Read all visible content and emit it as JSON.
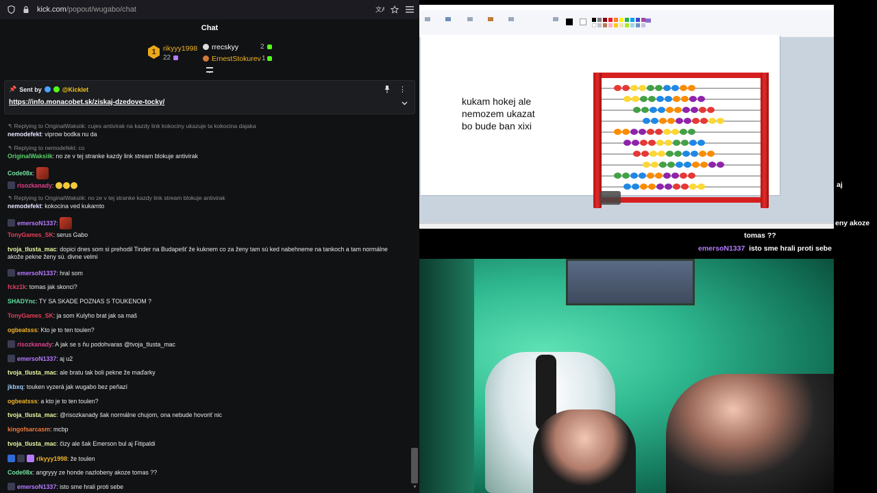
{
  "browser": {
    "url_host": "kick.com",
    "url_path": "/popout/wugabo/chat"
  },
  "chat": {
    "title": "Chat",
    "leaderboard": {
      "first": {
        "rank": "1",
        "name": "rikyyy1998",
        "count": "22"
      },
      "second": {
        "name": "rrecskyy",
        "count": "2"
      },
      "third": {
        "name": "ErnestStokurev",
        "count": "1"
      }
    },
    "pinned": {
      "sent_by_label": "Sent by",
      "author": "@Kicklet",
      "link": "https://info.monacobet.sk/ziskaj-dzedove-tocky/"
    },
    "messages": [
      {
        "type": "reply",
        "text": "Replying to OriginalWaksiik: cujes antivirak na kazdy link kokociny ukazuje ta kokocina dajaka"
      },
      {
        "user": "nemodefekt",
        "color": "#e6e6ff",
        "text": ": viprow bodka nu da"
      },
      {
        "type": "reply",
        "text": "Replying to nemodefekt: co"
      },
      {
        "user": "OriginalWaksiik",
        "color": "#59d36b",
        "text": ": no ze v tej stranke kazdy link stream blokuje antivirak"
      },
      {
        "user": "Code08x",
        "color": "#74e3a2",
        "text": ":"
      },
      {
        "user": "risozkanady",
        "color": "#e0408a",
        "text": ":"
      },
      {
        "type": "reply",
        "text": "Replying to OriginalWaksiik: no ze v tej stranke kazdy link stream blokuje antivirak"
      },
      {
        "user": "nemodefekt",
        "color": "#e6e6ff",
        "text": ": kokocina ved kukamto"
      },
      {
        "user": "emersoN1337",
        "color": "#b57bff",
        "text": ":"
      },
      {
        "user": "TonyGames_SK",
        "color": "#e0405a",
        "text": ": serus Gabo"
      },
      {
        "user": "tvoja_tlusta_mac",
        "color": "#e8f5a0",
        "text": ": dopici dnes som si prehodil Tinder na Budapešť že kuknem co za ženy tam sú ked nabehneme na tankoch a tam normálne akože pekne ženy sú. divne velmi"
      },
      {
        "user": "emersoN1337",
        "color": "#b57bff",
        "text": ": hral som"
      },
      {
        "user": "fckz1k",
        "color": "#e04060",
        "text": ": tomas jak skonci?"
      },
      {
        "user": "SHADYnc",
        "color": "#5fe0a0",
        "text": ": TY SA SKADE POZNAS S TOUKENOM ?"
      },
      {
        "user": "TonyGames_SK",
        "color": "#e0405a",
        "text": ": ja som Kulyho brat jak sa maš"
      },
      {
        "user": "ogbeatsss",
        "color": "#f0b429",
        "text": ": Kto je to ten toulen?"
      },
      {
        "user": "risozkanady",
        "color": "#e0408a",
        "text": ": A jak se s ňu podohvaras @tvoja_tlusta_mac"
      },
      {
        "user": "emersoN1337",
        "color": "#b57bff",
        "text": ": aj u2"
      },
      {
        "user": "tvoja_tlusta_mac",
        "color": "#e8f5a0",
        "text": ": ale bratu tak boli pekne že maďarky"
      },
      {
        "user": "jkbxq",
        "color": "#9fd0ff",
        "text": ": touken vyzerá jak wugabo bez peňazí"
      },
      {
        "user": "ogbeatsss",
        "color": "#f0b429",
        "text": ": a kto je to ten toulen?"
      },
      {
        "user": "tvoja_tlusta_mac",
        "color": "#e8f5a0",
        "text": ": @risozkanady šak normálne chujom, ona nebude hovoriť nic"
      },
      {
        "user": "kingofsarcasm",
        "color": "#f07a3a",
        "text": ": mcbp"
      },
      {
        "user": "tvoja_tlusta_mac",
        "color": "#e8f5a0",
        "text": ": čizy ale šak Emerson bul aj Fitipaldi"
      },
      {
        "user": "rikyyy1998",
        "color": "#f0b429",
        "text": ": že toulen"
      },
      {
        "user": "Code08x",
        "color": "#74e3a2",
        "text": ": angryyy ze honde nazlobeny akoze tomas ??"
      },
      {
        "user": "emersoN1337",
        "color": "#b57bff",
        "text": ": isto sme hrali proti sebe"
      }
    ]
  },
  "paint": {
    "canvas_text": "kukam hokej ale\nnemozem ukazat\nbo bude ban xixi"
  },
  "overlay": {
    "line1": "aj",
    "line2": "eny akoze",
    "line3": "tomas ??",
    "last_user": "emersoN1337",
    "last_text": "isto sme hrali proti sebe"
  },
  "colors": {
    "kick_green": "#53fc18",
    "gold": "#f0b429",
    "purple": "#b57bff"
  }
}
